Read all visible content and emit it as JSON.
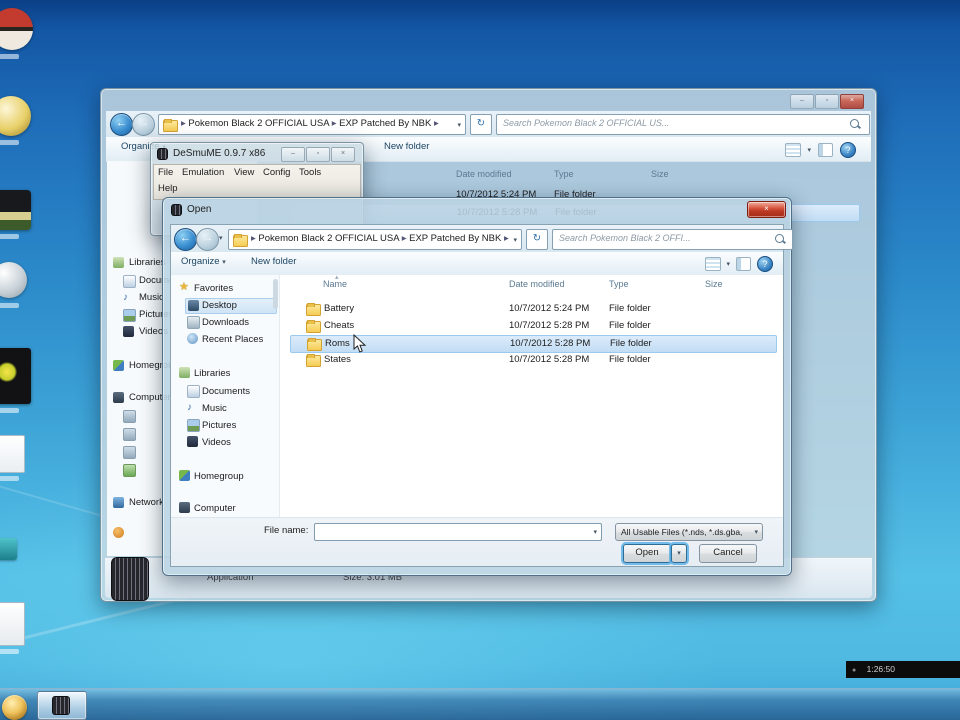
{
  "icons": {
    "chevron_down": "▾",
    "chevron_right": "▸",
    "back_arrow": "←",
    "refresh": "↻",
    "star": "★",
    "help": "?",
    "sort_asc": "▴",
    "minimize": "–",
    "maximize": "▫",
    "close": "×",
    "music_note": "♪",
    "record_dot": "●"
  },
  "desktop": {
    "overlay_timer": "1:26:50"
  },
  "taskbar": {
    "app_tooltip": "DeSmuME"
  },
  "explorer": {
    "breadcrumb": {
      "path1": "Pokemon Black 2 OFFICIAL USA",
      "path2": "EXP Patched By NBK"
    },
    "search_placeholder": "Search Pokemon Black 2 OFFICIAL US...",
    "toolbar": {
      "organize": "Organize",
      "new_folder": "New folder"
    },
    "columns": {
      "date": "Date modified",
      "type": "Type",
      "size": "Size"
    },
    "rows": [
      {
        "date": "10/7/2012 5:24 PM",
        "type": "File folder"
      },
      {
        "date": "10/7/2012 5:28 PM",
        "type": "File folder"
      }
    ],
    "sidebar": [
      "Libraries",
      "Documents",
      "Music",
      "Pictures",
      "Videos",
      "Homegroup",
      "Computer",
      "Network"
    ],
    "details": {
      "type": "Application",
      "size": "Size: 3.01 MB"
    }
  },
  "desmume": {
    "title": "DeSmuME 0.9.7 x86",
    "menu": [
      "File",
      "Emulation",
      "View",
      "Config",
      "Tools"
    ],
    "menu2": [
      "Help"
    ]
  },
  "dialog": {
    "title": "Open",
    "breadcrumb": {
      "path1": "Pokemon Black 2 OFFICIAL USA",
      "path2": "EXP Patched By NBK"
    },
    "search_placeholder": "Search Pokemon Black 2 OFFI...",
    "toolbar": {
      "organize": "Organize",
      "new_folder": "New folder"
    },
    "sidebar": [
      {
        "label": "Favorites"
      },
      {
        "label": "Desktop"
      },
      {
        "label": "Downloads"
      },
      {
        "label": "Recent Places"
      },
      {
        "label": "Libraries"
      },
      {
        "label": "Documents"
      },
      {
        "label": "Music"
      },
      {
        "label": "Pictures"
      },
      {
        "label": "Videos"
      },
      {
        "label": "Homegroup"
      },
      {
        "label": "Computer"
      }
    ],
    "columns": {
      "name": "Name",
      "date": "Date modified",
      "type": "Type",
      "size": "Size"
    },
    "files": [
      {
        "name": "Battery",
        "date": "10/7/2012 5:24 PM",
        "type": "File folder"
      },
      {
        "name": "Cheats",
        "date": "10/7/2012 5:28 PM",
        "type": "File folder"
      },
      {
        "name": "Roms",
        "date": "10/7/2012 5:28 PM",
        "type": "File folder"
      },
      {
        "name": "States",
        "date": "10/7/2012 5:28 PM",
        "type": "File folder"
      }
    ],
    "selected_file": "Roms",
    "footer": {
      "file_name_label": "File name:",
      "file_name_value": "",
      "filter_value": "All Usable Files (*.nds, *.ds.gba,",
      "open": "Open",
      "cancel": "Cancel"
    }
  }
}
